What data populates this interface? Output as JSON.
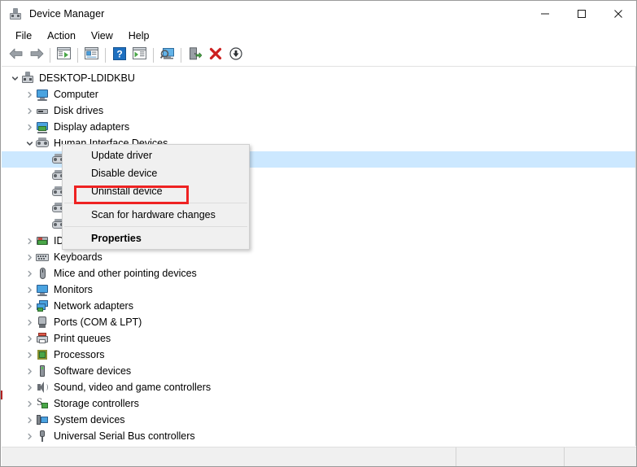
{
  "window": {
    "title": "Device Manager",
    "icon": "device-manager-icon",
    "controls": {
      "minimize": "minimize-icon",
      "maximize": "maximize-icon",
      "close": "close-icon"
    }
  },
  "menubar": {
    "items": [
      {
        "label": "File"
      },
      {
        "label": "Action"
      },
      {
        "label": "View"
      },
      {
        "label": "Help"
      }
    ]
  },
  "toolbar": {
    "buttons": [
      {
        "name": "back-button",
        "icon": "back-arrow-icon"
      },
      {
        "name": "forward-button",
        "icon": "forward-arrow-icon"
      },
      {
        "name": "show-hide-console-tree-button",
        "icon": "console-tree-icon"
      },
      {
        "name": "properties-button",
        "icon": "properties-window-icon"
      },
      {
        "name": "help-button",
        "icon": "question-mark-icon"
      },
      {
        "name": "show-hide-action-pane-button",
        "icon": "action-pane-icon"
      },
      {
        "name": "scan-for-hardware-changes-button",
        "icon": "scan-monitor-icon"
      },
      {
        "name": "update-driver-button",
        "icon": "update-driver-icon"
      },
      {
        "name": "uninstall-device-button",
        "icon": "red-x-icon"
      },
      {
        "name": "disable-device-button",
        "icon": "down-arrow-circle-icon"
      }
    ]
  },
  "tree": {
    "root": {
      "label": "DESKTOP-LDIDKBU",
      "icon": "computer-icon",
      "expanded": true
    },
    "nodes": [
      {
        "label": "Computer",
        "icon": "monitor-icon",
        "expanded": false
      },
      {
        "label": "Disk drives",
        "icon": "disk-drive-icon",
        "expanded": false
      },
      {
        "label": "Display adapters",
        "icon": "display-adapter-icon",
        "expanded": false
      },
      {
        "label": "Human Interface Devices",
        "icon": "hid-icon",
        "expanded": true
      },
      {
        "label": "IDE ATA/ATAPI controllers",
        "icon": "ide-controller-icon",
        "expanded": false,
        "occluded": true
      },
      {
        "label": "Keyboards",
        "icon": "keyboard-icon",
        "expanded": false,
        "occluded": true
      },
      {
        "label": "Mice and other pointing devices",
        "icon": "mouse-icon",
        "expanded": false
      },
      {
        "label": "Monitors",
        "icon": "monitor-icon",
        "expanded": false
      },
      {
        "label": "Network adapters",
        "icon": "network-adapter-icon",
        "expanded": false
      },
      {
        "label": "Ports (COM & LPT)",
        "icon": "port-icon",
        "expanded": false
      },
      {
        "label": "Print queues",
        "icon": "printer-icon",
        "expanded": false
      },
      {
        "label": "Processors",
        "icon": "processor-icon",
        "expanded": false
      },
      {
        "label": "Software devices",
        "icon": "software-device-icon",
        "expanded": false
      },
      {
        "label": "Sound, video and game controllers",
        "icon": "sound-controller-icon",
        "expanded": false
      },
      {
        "label": "Storage controllers",
        "icon": "storage-controller-icon",
        "expanded": false
      },
      {
        "label": "System devices",
        "icon": "system-device-icon",
        "expanded": false
      },
      {
        "label": "Universal Serial Bus controllers",
        "icon": "usb-controller-icon",
        "expanded": false
      }
    ],
    "hid_children_count": 5,
    "hid_child_icon": "hid-icon"
  },
  "context_menu": {
    "items": [
      {
        "label": "Update driver",
        "bold": false,
        "highlighted": false
      },
      {
        "label": "Disable device",
        "bold": false,
        "highlighted": false
      },
      {
        "label": "Uninstall device",
        "bold": false,
        "highlighted": true
      },
      {
        "separator": true
      },
      {
        "label": "Scan for hardware changes",
        "bold": false,
        "highlighted": false
      },
      {
        "separator": true
      },
      {
        "label": "Properties",
        "bold": true,
        "highlighted": false
      }
    ],
    "highlight_color": "#ee2222"
  },
  "statusbar": {
    "panes": [
      "",
      "",
      ""
    ]
  },
  "colors": {
    "selection": "#cce8ff",
    "menu_bg": "#f0f0f0",
    "highlight_red": "#ee2222",
    "window_bg": "#ffffff"
  }
}
